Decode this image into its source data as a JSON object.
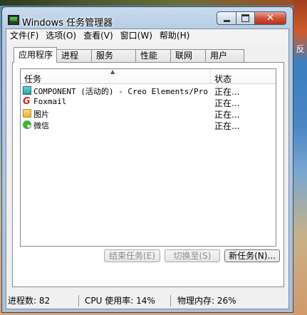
{
  "window": {
    "title": "Windows 任务管理器",
    "controls": {
      "minimize": "",
      "maximize": "",
      "close": "✕"
    }
  },
  "menu": [
    "文件(F)",
    "选项(O)",
    "查看(V)",
    "窗口(W)",
    "帮助(H)"
  ],
  "tabs": [
    "应用程序",
    "进程",
    "服务",
    "性能",
    "联网",
    "用户"
  ],
  "active_tab": "应用程序",
  "list": {
    "columns": [
      "任务",
      "状态"
    ],
    "sort_indicator": "▲",
    "rows": [
      {
        "icon": "component-icon",
        "name": "COMPONENT (活动的) - Creo Elements/Pro",
        "status": "正在..."
      },
      {
        "icon": "foxmail-icon",
        "name": "Foxmail",
        "status": "正在..."
      },
      {
        "icon": "folder-icon",
        "name": "图片",
        "status": "正在..."
      },
      {
        "icon": "wechat-icon",
        "name": "微信",
        "status": "正在..."
      }
    ]
  },
  "buttons": {
    "end_task": "结束任务(E)",
    "switch_to": "切换至(S)",
    "new_task": "新任务(N)..."
  },
  "statusbar": {
    "processes": "进程数: 82",
    "cpu": "CPU 使用率: 14%",
    "memory": "物理内存: 26%"
  },
  "desktop_glyphs": [
    "反",
    "",
    "",
    ""
  ]
}
